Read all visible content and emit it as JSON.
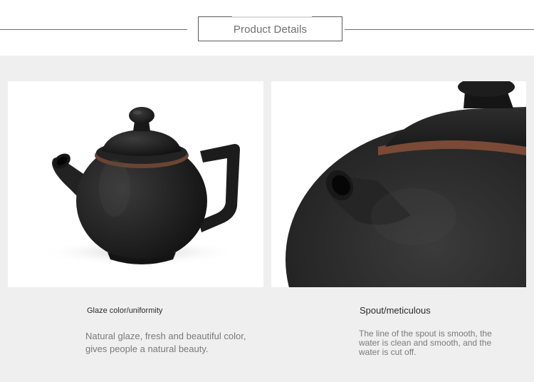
{
  "header": {
    "title": "Product Details"
  },
  "features": [
    {
      "title": "Glaze color/uniformity",
      "description": "Natural glaze, fresh and beautiful color, gives people a natural beauty."
    },
    {
      "title": "Spout/meticulous",
      "description": "The line of the spout is smooth, the water is clean and smooth, and the water is cut off."
    }
  ],
  "colors": {
    "background": "#efefef",
    "header_background": "#ffffff",
    "teapot_glaze": "#1f1f1f",
    "rim_clay": "#7a4a36"
  }
}
